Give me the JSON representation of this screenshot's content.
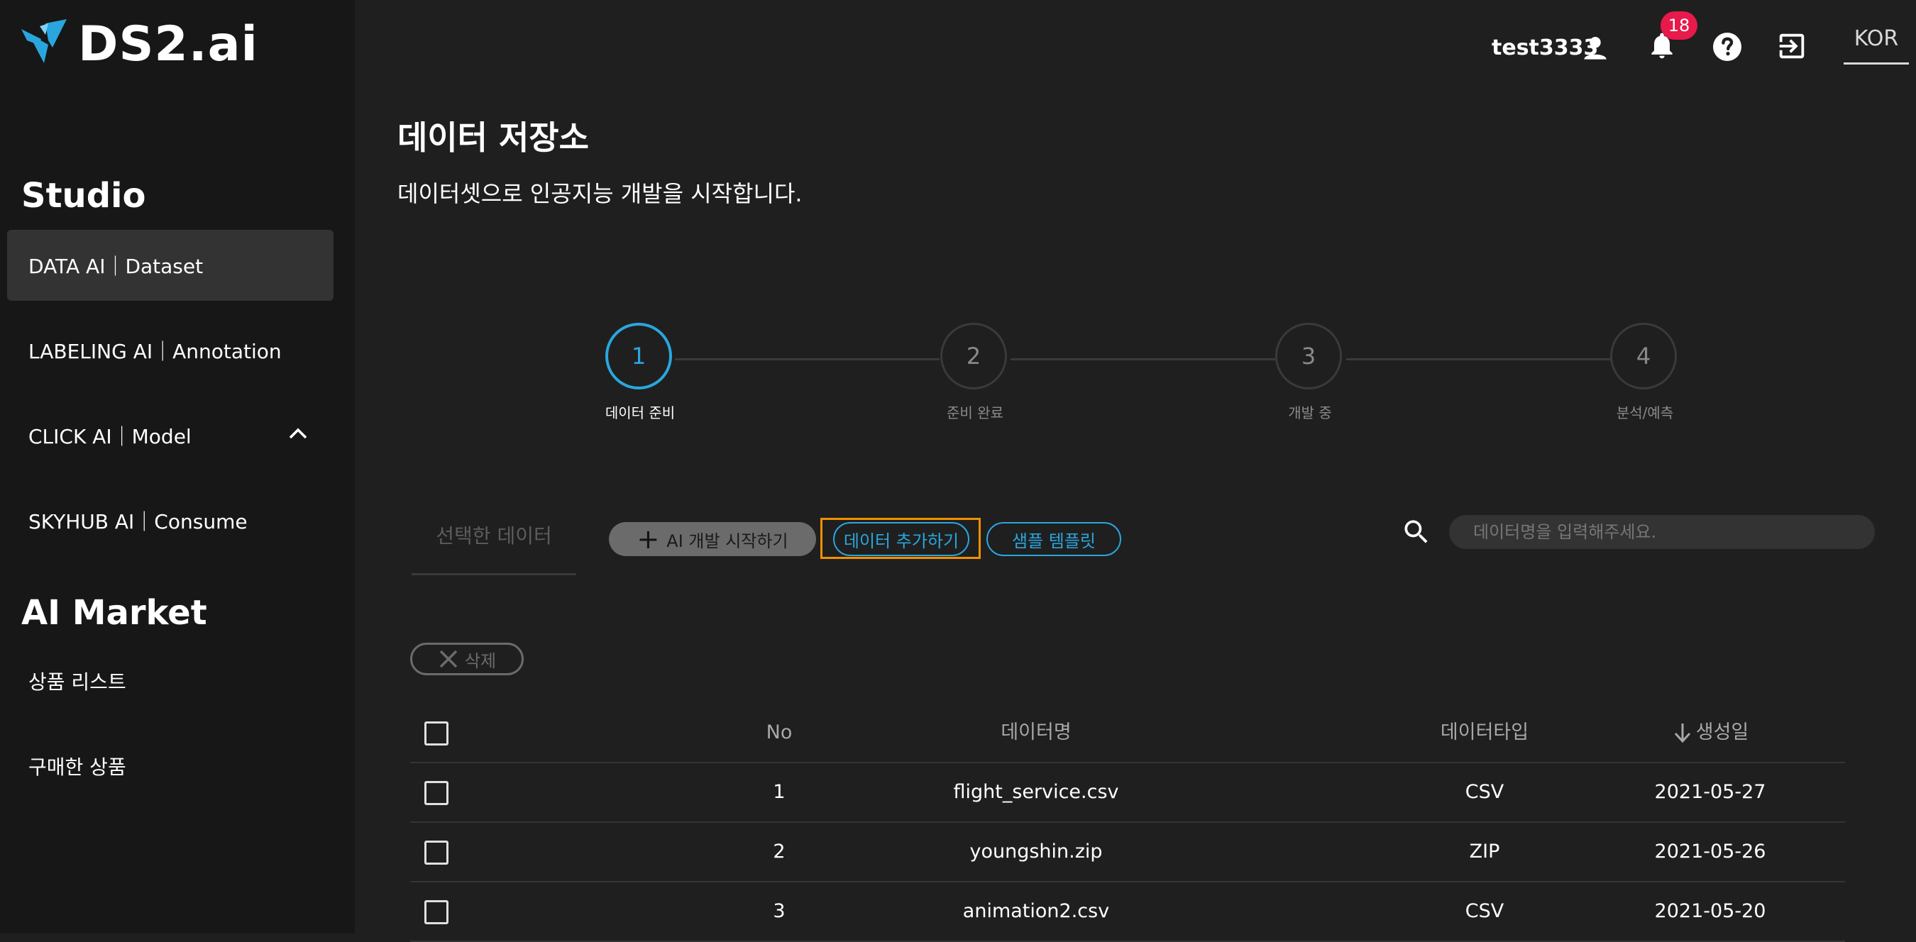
{
  "brand": {
    "name": "DS2.ai",
    "logo_icon": "ds2-logo-icon"
  },
  "sidebar": {
    "studio_title": "Studio",
    "items": [
      {
        "label": "DATA AI｜Dataset",
        "active": true
      },
      {
        "label": "LABELING AI｜Annotation"
      },
      {
        "label": "CLICK AI｜Model",
        "expanded": true
      },
      {
        "label": "SKYHUB AI｜Consume"
      }
    ],
    "market_title": "AI Market",
    "market_items": [
      {
        "label": "상품 리스트"
      },
      {
        "label": "구매한 상품"
      }
    ]
  },
  "topbar": {
    "username": "test3333",
    "notification_count": "18",
    "language": "KOR",
    "icons": [
      "user-icon",
      "bell-icon",
      "help-icon",
      "logout-icon"
    ]
  },
  "page": {
    "title": "데이터 저장소",
    "subtitle": "데이터셋으로 인공지능 개발을 시작합니다."
  },
  "steps": [
    {
      "number": "1",
      "label": "데이터 준비",
      "active": true
    },
    {
      "number": "2",
      "label": "준비 완료"
    },
    {
      "number": "3",
      "label": "개발 중"
    },
    {
      "number": "4",
      "label": "분석/예측"
    }
  ],
  "toolbar": {
    "tab_selected_data": "선택한 데이터",
    "start_ai_label": "AI 개발 시작하기",
    "add_data_label": "데이터 추가하기",
    "sample_template_label": "샘플 템플릿",
    "search_placeholder": "데이터명을 입력해주세요.",
    "delete_label": "삭제"
  },
  "table": {
    "columns": {
      "no": "No",
      "name": "데이터명",
      "type": "데이터타입",
      "date": "생성일"
    },
    "rows": [
      {
        "no": "1",
        "name": "flight_service.csv",
        "type": "CSV",
        "date": "2021-05-27"
      },
      {
        "no": "2",
        "name": "youngshin.zip",
        "type": "ZIP",
        "date": "2021-05-26"
      },
      {
        "no": "3",
        "name": "animation2.csv",
        "type": "CSV",
        "date": "2021-05-20"
      }
    ]
  },
  "colors": {
    "accent": "#2aa6de",
    "highlight": "#f29000",
    "badge": "#e8194b",
    "background": "#1f1f1f",
    "sidebar": "#171717"
  }
}
